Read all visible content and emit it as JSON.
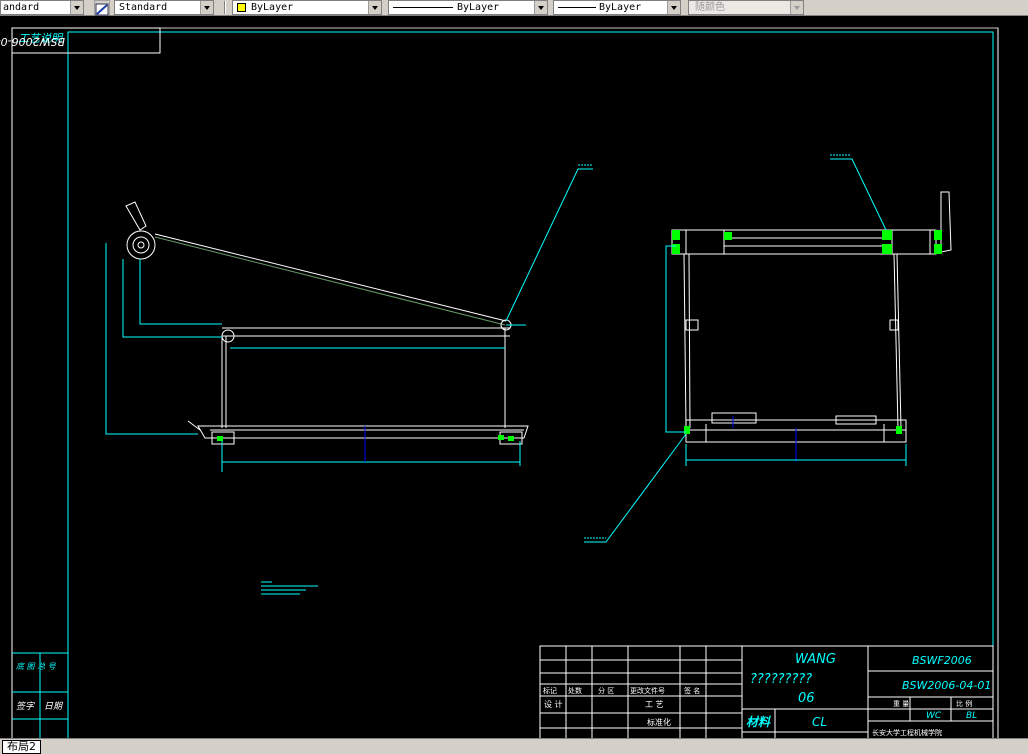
{
  "toolbar": {
    "text_style": "andard",
    "dim_style": "Standard",
    "layer": "ByLayer",
    "linetype": "ByLayer",
    "lineweight": "ByLayer",
    "plot_style": "随颜色",
    "layer_color": "#ffff00"
  },
  "side_panel": {
    "process_note": "工艺说明",
    "mirrored_code": "BSW2006-04-01",
    "base_drawing_no": "底 图 总 号",
    "sign": "签字",
    "date": "日期"
  },
  "title_block": {
    "company": "WANG",
    "unreadable_name": "?????????",
    "sheet_no": "06",
    "series_no": "BSWF2006",
    "drawing_no": "BSW2006-04-01",
    "material_label": "材料",
    "material": "CL",
    "mark": "标记",
    "count": "处数",
    "zone": "分 区",
    "change_doc": "更改文件号",
    "signature": "签 名",
    "design": "设 计",
    "process": "工 艺",
    "standardize": "标准化",
    "weight": "重 量",
    "scale": "比 例",
    "wc": "WC",
    "bl": "BL",
    "school": "长安大学工程机械学院"
  },
  "layout_tab": {
    "label": "布局2"
  }
}
